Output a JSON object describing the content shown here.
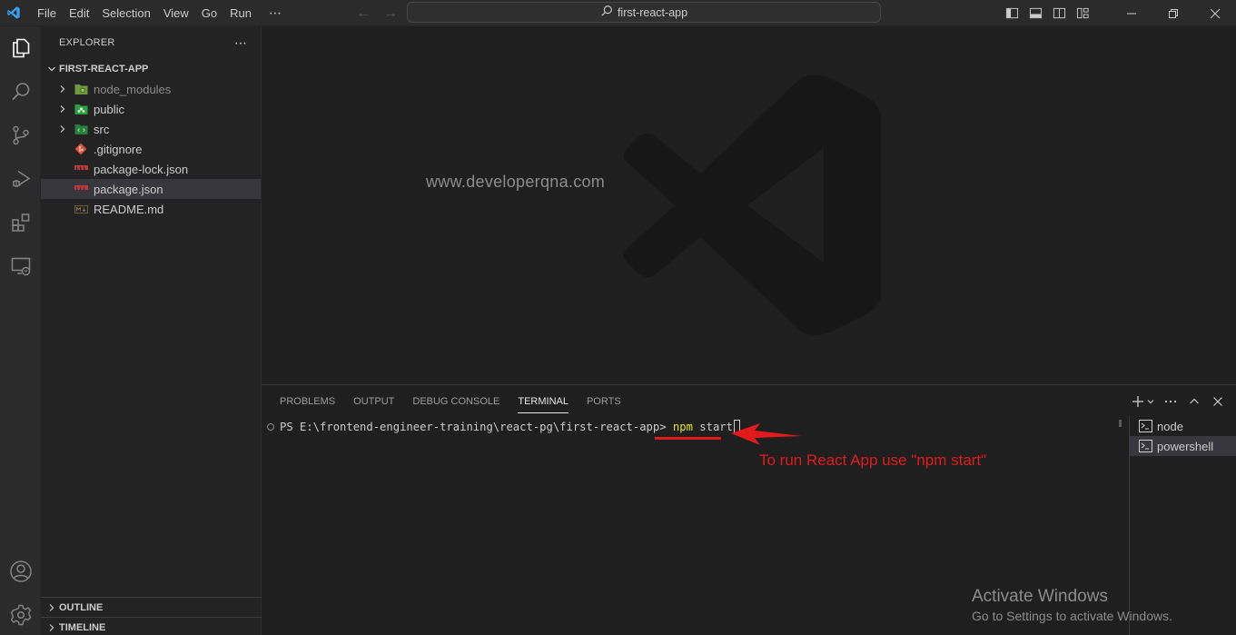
{
  "titlebar": {
    "menu": [
      "File",
      "Edit",
      "Selection",
      "View",
      "Go",
      "Run"
    ],
    "more": "⋯",
    "nav_back": "←",
    "nav_forward": "→",
    "search_text": "first-react-app",
    "layout_buttons": [
      "toggle-primary-sidebar",
      "toggle-panel",
      "toggle-secondary-sidebar",
      "customize-layout"
    ],
    "window_buttons": [
      "minimize",
      "restore",
      "close"
    ]
  },
  "activitybar": {
    "items": [
      "explorer",
      "search",
      "source-control",
      "run-and-debug",
      "extensions",
      "remote-explorer"
    ],
    "bottom": [
      "accounts",
      "manage"
    ]
  },
  "sidebar": {
    "title": "EXPLORER",
    "more": "⋯",
    "project": "FIRST-REACT-APP",
    "tree": [
      {
        "label": "node_modules",
        "type": "folder",
        "icon": "node-folder-icon",
        "dim": true
      },
      {
        "label": "public",
        "type": "folder",
        "icon": "public-folder-icon",
        "dim": false
      },
      {
        "label": "src",
        "type": "folder",
        "icon": "src-folder-icon",
        "dim": false
      },
      {
        "label": ".gitignore",
        "type": "file",
        "icon": "git-icon",
        "dim": false
      },
      {
        "label": "package-lock.json",
        "type": "file",
        "icon": "npm-icon",
        "dim": false
      },
      {
        "label": "package.json",
        "type": "file",
        "icon": "npm-icon",
        "dim": false,
        "selected": true
      },
      {
        "label": "README.md",
        "type": "file",
        "icon": "markdown-icon",
        "dim": false
      }
    ],
    "outline": "OUTLINE",
    "timeline": "TIMELINE"
  },
  "editor": {
    "watermark_text": "www.developerqna.com"
  },
  "panel": {
    "tabs": [
      "PROBLEMS",
      "OUTPUT",
      "DEBUG CONSOLE",
      "TERMINAL",
      "PORTS"
    ],
    "active_tab": "TERMINAL",
    "prompt": "PS E:\\frontend-engineer-training\\react-pg\\first-react-app> ",
    "cmd_npm": "npm",
    "cmd_rest": " start",
    "annotation": "To run React App use \"npm start\"",
    "terminals": [
      {
        "label": "node",
        "selected": false
      },
      {
        "label": "powershell",
        "selected": true
      }
    ]
  },
  "activation": {
    "title": "Activate Windows",
    "subtitle": "Go to Settings to activate Windows."
  },
  "colors": {
    "annotation_red": "#e11b1b",
    "npm_yellow": "#e5e510",
    "vscode_blue": "#3aa0f0"
  }
}
